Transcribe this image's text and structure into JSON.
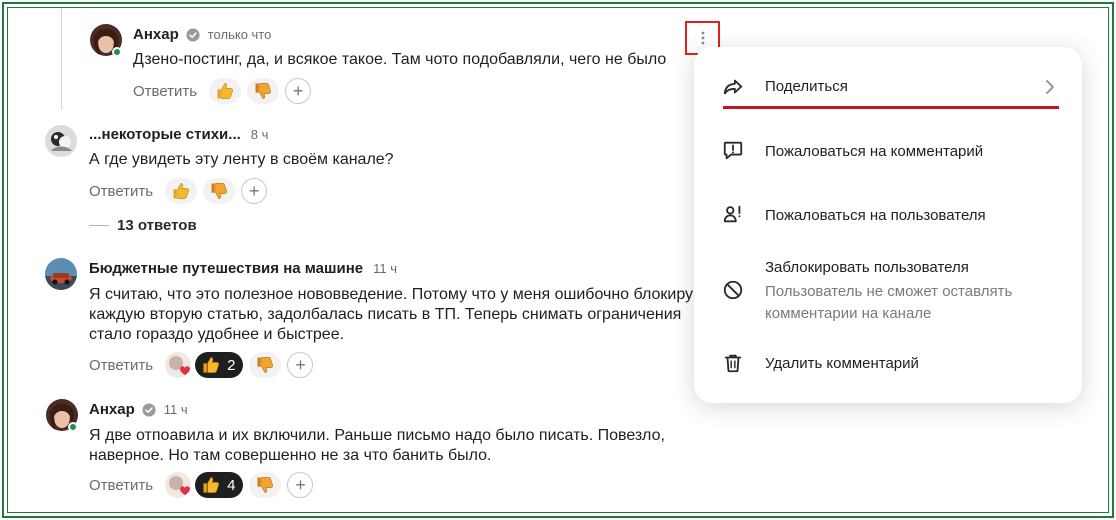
{
  "colors": {
    "frame": "#1e7a3c",
    "highlight": "#e02020",
    "underline": "#c4161c",
    "online": "#1e8e4e"
  },
  "comments": [
    {
      "author": "Анхар",
      "verified": true,
      "time": "только что",
      "text": "Дзено-постинг, да, и всякое такое. Там чото подобавляли, чего не было",
      "reply_label": "Ответить"
    },
    {
      "author": "...некоторые стихи...",
      "verified": false,
      "time": "8 ч",
      "text": "А где увидеть эту ленту в своём канале?",
      "reply_label": "Ответить",
      "replies_label": "13 ответов"
    },
    {
      "author": "Бюджетные путешествия на машине",
      "verified": false,
      "time": "11 ч",
      "text_lines": [
        "Я считаю, что это полезное нововведение. Потому что у меня ошибочно блокиру",
        "каждую вторую статью, задолбалась писать в ТП. Теперь снимать ограничения",
        "стало гораздо удобнее и быстрее."
      ],
      "reply_label": "Ответить",
      "like_count": "2"
    },
    {
      "author": "Анхар",
      "verified": true,
      "time": "11 ч",
      "text_lines": [
        "Я две отпоавила и их включили. Раньше письмо надо было писать. Повезло,",
        "наверное. Но там совершенно не за что банить было."
      ],
      "reply_label": "Ответить",
      "like_count": "4"
    }
  ],
  "menu": {
    "share": "Поделиться",
    "report_comment": "Пожаловаться на комментарий",
    "report_user": "Пожаловаться на пользователя",
    "block_user": "Заблокировать пользователя",
    "block_user_hint_lines": [
      "Пользователь не сможет оставлять",
      "комментарии на канале"
    ],
    "delete_comment": "Удалить комментарий"
  },
  "icons": {
    "more": "vertical-ellipsis-icon",
    "share": "share-arrow-icon",
    "report_comment": "exclamation-bubble-icon",
    "report_user": "user-exclamation-icon",
    "block": "block-icon",
    "delete": "trash-icon",
    "like": "thumbs-up-icon",
    "dislike": "thumbs-down-icon",
    "add_reaction": "plus-icon",
    "verified": "verified-check-icon"
  }
}
